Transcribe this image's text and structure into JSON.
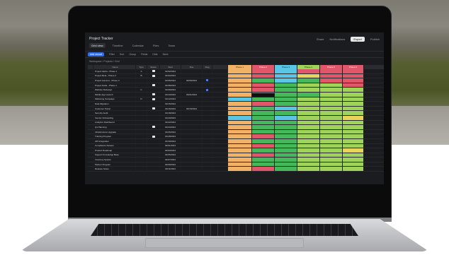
{
  "colors": {
    "accent": "#2f6cf0",
    "orange": "#f2b266",
    "red": "#e0566a",
    "green": "#46b85c",
    "lime": "#9fd35a",
    "cyan": "#59c6e6",
    "yellow": "#e9d45a"
  },
  "app": {
    "title": "Project Tracker",
    "actions": [
      "Share",
      "Notifications",
      "Export",
      "Publish"
    ]
  },
  "tabs": [
    "Grid view",
    "Timeline",
    "Calendar",
    "Files",
    "Team"
  ],
  "toolbar": [
    "Add record",
    "Filter",
    "Sort",
    "Group",
    "Fields",
    "Hide",
    "More"
  ],
  "breadcrumb": "Workspace / Projects / Grid",
  "columns": [
    "",
    "Name",
    "Type",
    "Status",
    "Start",
    "Due",
    "Flag",
    "",
    "Phase 1",
    "Phase 2",
    "Phase 3",
    "Phase 4",
    "Phase 5",
    "Phase 6"
  ],
  "rows": [
    {
      "name": "Project Alpha - Phase 1",
      "a": "A",
      "b": "sq",
      "start": "01/02/2024",
      "due": "",
      "flag": "",
      "cells": [
        "o",
        "r",
        "c",
        "r",
        "r",
        "r"
      ]
    },
    {
      "name": "Project Beta - Phase 2",
      "a": "B",
      "b": "sq",
      "start": "01/04/2024",
      "due": "",
      "flag": "",
      "cells": [
        "o",
        "r",
        "c",
        "y",
        "r",
        "r"
      ]
    },
    {
      "name": "Project Gamma - Phase 3",
      "a": "",
      "b": "",
      "start": "01/05/2024",
      "due": "02/06/2024",
      "flag": "f",
      "cells": [
        "o",
        "g",
        "c",
        "g",
        "r",
        "r"
      ]
    },
    {
      "name": "Project Delta - Phase 4",
      "a": "",
      "b": "sq",
      "start": "01/08/2024",
      "due": "",
      "flag": "",
      "cells": [
        "o",
        "r",
        "g",
        "l",
        "l",
        "r"
      ]
    },
    {
      "name": "Website Redesign",
      "a": "C",
      "b": "",
      "start": "01/09/2024",
      "due": "",
      "flag": "f",
      "cells": [
        "o",
        "r",
        "g",
        "l",
        "l",
        "l"
      ]
    },
    {
      "name": "Mobile App Launch",
      "a": "",
      "b": "sq",
      "start": "01/10/2024",
      "due": "03/01/2024",
      "flag": "",
      "cells": [
        "o",
        "b",
        "g",
        "g",
        "l",
        "l"
      ]
    },
    {
      "name": "Marketing Campaign",
      "a": "D",
      "b": "sq",
      "start": "01/12/2024",
      "due": "",
      "flag": "",
      "cells": [
        "c",
        "g",
        "g",
        "l",
        "l",
        "l"
      ]
    },
    {
      "name": "Data Migration",
      "a": "",
      "b": "",
      "start": "01/15/2024",
      "due": "",
      "flag": "",
      "cells": [
        "o",
        "r",
        "g",
        "l",
        "l",
        "l"
      ]
    },
    {
      "name": "Customer Portal",
      "a": "",
      "b": "sq",
      "start": "01/16/2024",
      "due": "03/15/2024",
      "flag": "",
      "cells": [
        "o",
        "g",
        "c",
        "l",
        "l",
        "l"
      ]
    },
    {
      "name": "Security Audit",
      "a": "",
      "b": "",
      "start": "01/18/2024",
      "due": "",
      "flag": "",
      "cells": [
        "o",
        "g",
        "g",
        "l",
        "l",
        "l"
      ]
    },
    {
      "name": "Vendor Onboarding",
      "a": "",
      "b": "",
      "start": "01/20/2024",
      "due": "",
      "flag": "",
      "cells": [
        "c",
        "g",
        "c",
        "l",
        "l",
        "y"
      ]
    },
    {
      "name": "Analytics Dashboard",
      "a": "",
      "b": "",
      "start": "01/22/2024",
      "due": "",
      "flag": "",
      "cells": [
        "o",
        "g",
        "g",
        "l",
        "l",
        "l"
      ]
    },
    {
      "name": "Q1 Planning",
      "a": "",
      "b": "sq",
      "start": "01/24/2024",
      "due": "",
      "flag": "",
      "cells": [
        "o",
        "g",
        "g",
        "l",
        "l",
        "l"
      ]
    },
    {
      "name": "Infrastructure Upgrade",
      "a": "",
      "b": "",
      "start": "01/26/2024",
      "due": "",
      "flag": "",
      "cells": [
        "o",
        "g",
        "g",
        "l",
        "l",
        "l"
      ]
    },
    {
      "name": "Training Program",
      "a": "",
      "b": "sq",
      "start": "01/28/2024",
      "due": "",
      "flag": "",
      "cells": [
        "o",
        "r",
        "g",
        "l",
        "l",
        "l"
      ]
    },
    {
      "name": "API Integration",
      "a": "",
      "b": "",
      "start": "01/30/2024",
      "due": "",
      "flag": "",
      "cells": [
        "o",
        "g",
        "g",
        "l",
        "l",
        "l"
      ]
    },
    {
      "name": "Compliance Review",
      "a": "",
      "b": "",
      "start": "02/01/2024",
      "due": "",
      "flag": "",
      "cells": [
        "o",
        "r",
        "g",
        "l",
        "l",
        "l"
      ]
    },
    {
      "name": "Product Roadmap",
      "a": "",
      "b": "",
      "start": "02/03/2024",
      "due": "",
      "flag": "",
      "cells": [
        "o",
        "g",
        "g",
        "l",
        "l",
        "y"
      ]
    },
    {
      "name": "Support Knowledge Base",
      "a": "",
      "b": "",
      "start": "02/05/2024",
      "due": "",
      "flag": "",
      "cells": [
        "o",
        "r",
        "g",
        "l",
        "l",
        "l"
      ]
    },
    {
      "name": "Inventory System",
      "a": "",
      "b": "",
      "start": "02/07/2024",
      "due": "",
      "flag": "",
      "cells": [
        "o",
        "g",
        "g",
        "l",
        "l",
        "l"
      ]
    },
    {
      "name": "Partner Program",
      "a": "",
      "b": "",
      "start": "02/09/2024",
      "due": "",
      "flag": "",
      "cells": [
        "o",
        "g",
        "g",
        "l",
        "l",
        "l"
      ]
    },
    {
      "name": "Release Notes",
      "a": "",
      "b": "",
      "start": "02/11/2024",
      "due": "",
      "flag": "",
      "cells": [
        "o",
        "r",
        "g",
        "l",
        "l",
        "l"
      ]
    }
  ]
}
